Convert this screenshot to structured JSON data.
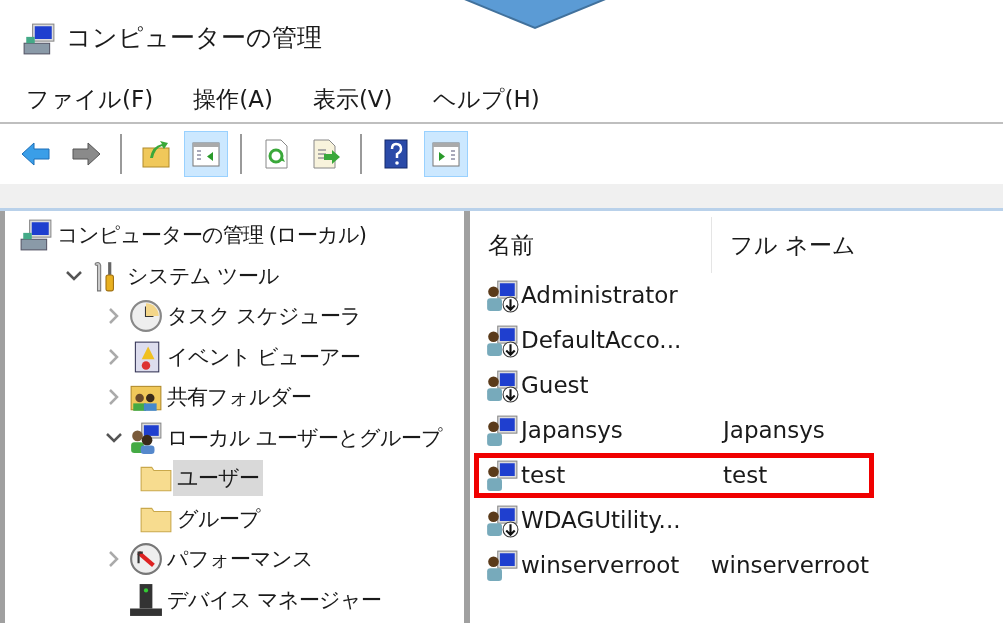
{
  "window": {
    "title": "コンピューターの管理"
  },
  "menu": [
    {
      "label": "ファイル(F)"
    },
    {
      "label": "操作(A)"
    },
    {
      "label": "表示(V)"
    },
    {
      "label": "ヘルプ(H)"
    }
  ],
  "toolbar": [
    {
      "kind": "back",
      "pressed": false
    },
    {
      "kind": "forward",
      "pressed": false
    },
    {
      "kind": "separator"
    },
    {
      "kind": "up",
      "pressed": false
    },
    {
      "kind": "tree",
      "pressed": true
    },
    {
      "kind": "separator"
    },
    {
      "kind": "refresh",
      "pressed": false
    },
    {
      "kind": "export",
      "pressed": false
    },
    {
      "kind": "separator"
    },
    {
      "kind": "help",
      "pressed": false
    },
    {
      "kind": "actions",
      "pressed": true
    }
  ],
  "tree": [
    {
      "label": "コンピューターの管理 (ローカル)",
      "kind": "computer",
      "selected": false,
      "children": [
        {
          "label": "システム ツール",
          "kind": "tools",
          "expanded": true,
          "selected": false,
          "children": [
            {
              "label": "タスク スケジューラ",
              "kind": "clock",
              "expanded": false,
              "selected": false
            },
            {
              "label": "イベント ビューアー",
              "kind": "log",
              "expanded": false,
              "selected": false
            },
            {
              "label": "共有フォルダー",
              "kind": "shared",
              "expanded": false,
              "selected": false
            },
            {
              "label": "ローカル ユーザーとグループ",
              "kind": "users",
              "expanded": true,
              "selected": false,
              "children": [
                {
                  "label": "ユーザー",
                  "kind": "folder",
                  "selected": true
                },
                {
                  "label": "グループ",
                  "kind": "folder",
                  "selected": false
                }
              ]
            },
            {
              "label": "パフォーマンス",
              "kind": "perf",
              "expanded": false,
              "selected": false
            },
            {
              "label": "デバイス マネージャー",
              "kind": "device",
              "selected": false
            }
          ]
        }
      ]
    }
  ],
  "table": {
    "columns": [
      "名前",
      "フル ネーム"
    ],
    "rows": [
      {
        "name": "Administrator",
        "full_name": "",
        "disabled": true,
        "highlighted": false
      },
      {
        "name": "DefaultAcco...",
        "full_name": "",
        "disabled": true,
        "highlighted": false
      },
      {
        "name": "Guest",
        "full_name": "",
        "disabled": true,
        "highlighted": false
      },
      {
        "name": "Japansys",
        "full_name": "Japansys",
        "disabled": false,
        "highlighted": false
      },
      {
        "name": "test",
        "full_name": "test",
        "disabled": false,
        "highlighted": true
      },
      {
        "name": "WDAGUtility...",
        "full_name": "",
        "disabled": true,
        "highlighted": false
      },
      {
        "name": "winserverroot",
        "full_name": "winserverroot",
        "disabled": false,
        "highlighted": false
      }
    ]
  }
}
